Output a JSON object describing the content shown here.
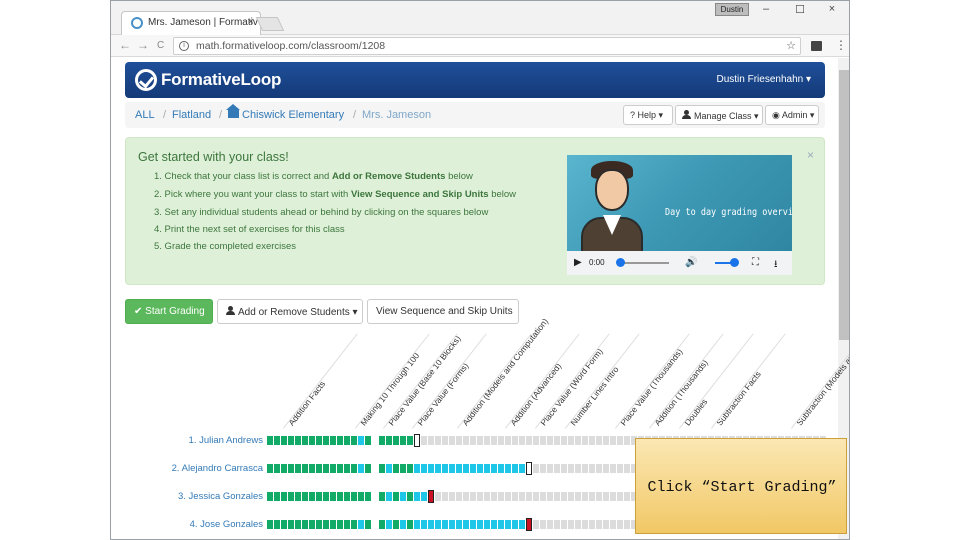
{
  "browser": {
    "tab_title": "Mrs. Jameson | Formativ",
    "tab_close": "×",
    "user_chip": "Dustin",
    "minimize": "–",
    "restore": "☐",
    "close": "×",
    "back": "←",
    "forward": "→",
    "reload": "C",
    "url": "math.formativeloop.com/classroom/1208",
    "info_glyph": "i",
    "star": "☆",
    "menu": "⋮"
  },
  "navbar": {
    "brand": "FormativeLoop",
    "user": "Dustin Friesenhahn ▾"
  },
  "breadcrumb": {
    "items": [
      "ALL",
      "Flatland",
      "Chiswick Elementary",
      "Mrs. Jameson"
    ],
    "separator": "/"
  },
  "toolbar": {
    "help": "Help ▾",
    "manage": "Manage Class ▾",
    "admin": "Admin ▾",
    "help_glyph": "?",
    "admin_glyph": "◉"
  },
  "alert": {
    "title": "Get started with your class!",
    "close": "×",
    "steps": [
      {
        "pre": "1. Check that your class list is correct and ",
        "bold": "Add or Remove Students",
        "post": " below"
      },
      {
        "pre": "2. Pick where you want your class to start with ",
        "bold": "View Sequence and Skip Units",
        "post": " below"
      },
      {
        "pre": "3. Set any individual students ahead or behind by clicking on the squares below",
        "bold": "",
        "post": ""
      },
      {
        "pre": "4. Print the next set of exercises for this class",
        "bold": "",
        "post": ""
      },
      {
        "pre": "5. Grade the completed exercises",
        "bold": "",
        "post": ""
      }
    ]
  },
  "video": {
    "caption": "Day to day grading overview",
    "time": "0:00",
    "play": "▶",
    "volume": "🔊",
    "fullscreen": "⛶",
    "download": "⭳"
  },
  "actions": {
    "start": "Start Grading",
    "start_glyph": "✔",
    "add": "Add or Remove Students ▾",
    "sequence": "View Sequence and Skip Units"
  },
  "units": [
    "Addition Facts",
    "Making 10 Through 100",
    "Place Value (Base 10 Blocks)",
    "Place Value (Forms)",
    "Addition (Models and Computation)",
    "Addition (Advanced)",
    "Place Value (Word Form)",
    "Number Lines Intro",
    "Place Value (Thousands)",
    "Addition (Thousands)",
    "Doubles",
    "Subtraction Facts",
    "Subtraction (Models and Computation)"
  ],
  "students": [
    {
      "name": "1. Julian Andrews",
      "cells": [
        "g",
        "g",
        "g",
        "g",
        "g",
        "g",
        "g",
        "g",
        "g",
        "g",
        "g",
        "g",
        "g",
        "c",
        "g",
        "x",
        "g",
        "g",
        "g",
        "g",
        "g",
        "w",
        "l",
        "l",
        "l",
        "l",
        "l",
        "l",
        "l",
        "l",
        "l",
        "l",
        "l",
        "l",
        "l",
        "l",
        "l",
        "l",
        "l",
        "l",
        "l",
        "l",
        "l",
        "l",
        "l",
        "l",
        "l",
        "l",
        "l",
        "l",
        "l",
        "l",
        "l",
        "l",
        "l",
        "l",
        "l",
        "l",
        "l",
        "l",
        "l",
        "l",
        "l",
        "l",
        "l",
        "l",
        "l",
        "l",
        "l",
        "l",
        "l",
        "l",
        "l",
        "l",
        "l",
        "l",
        "l",
        "l",
        "l",
        "l",
        "l",
        "l",
        "l"
      ]
    },
    {
      "name": "2. Alejandro Carrasca",
      "cells": [
        "g",
        "g",
        "g",
        "g",
        "g",
        "g",
        "g",
        "g",
        "g",
        "g",
        "g",
        "g",
        "g",
        "c",
        "g",
        "x",
        "g",
        "c",
        "g",
        "g",
        "g",
        "c",
        "c",
        "c",
        "c",
        "c",
        "c",
        "c",
        "c",
        "c",
        "c",
        "c",
        "c",
        "c",
        "c",
        "c",
        "c",
        "w",
        "l",
        "l",
        "l",
        "l",
        "l",
        "l",
        "l",
        "l",
        "l",
        "l",
        "l",
        "l",
        "l",
        "l",
        "l",
        "l",
        "l",
        "l",
        "l",
        "l",
        "l",
        "l",
        "l",
        "l",
        "l",
        "l",
        "l",
        "l",
        "l",
        "l",
        "l",
        "l",
        "l",
        "l",
        "l",
        "l",
        "l",
        "l",
        "l",
        "l",
        "l",
        "l",
        "l",
        "l",
        "l"
      ]
    },
    {
      "name": "3. Jessica Gonzales",
      "cells": [
        "g",
        "g",
        "g",
        "g",
        "g",
        "g",
        "g",
        "g",
        "g",
        "g",
        "g",
        "g",
        "g",
        "g",
        "g",
        "x",
        "g",
        "c",
        "g",
        "c",
        "g",
        "c",
        "c",
        "r",
        "l",
        "l",
        "l",
        "l",
        "l",
        "l",
        "l",
        "l",
        "l",
        "l",
        "l",
        "l",
        "l",
        "l",
        "l",
        "l",
        "l",
        "l",
        "l",
        "l",
        "l",
        "l",
        "l",
        "l",
        "l",
        "l",
        "l",
        "l",
        "l",
        "l",
        "l",
        "l",
        "l",
        "l",
        "l",
        "l",
        "l",
        "l",
        "l",
        "l",
        "l",
        "l",
        "l",
        "l",
        "l",
        "l",
        "l",
        "l",
        "l",
        "l",
        "l",
        "l",
        "l",
        "l",
        "l",
        "l",
        "l",
        "l",
        "l"
      ]
    },
    {
      "name": "4. Jose Gonzales",
      "cells": [
        "g",
        "g",
        "g",
        "g",
        "g",
        "g",
        "g",
        "g",
        "g",
        "g",
        "g",
        "g",
        "g",
        "c",
        "g",
        "x",
        "g",
        "c",
        "g",
        "c",
        "g",
        "c",
        "c",
        "c",
        "c",
        "c",
        "c",
        "c",
        "c",
        "c",
        "c",
        "c",
        "c",
        "c",
        "c",
        "c",
        "c",
        "r",
        "l",
        "l",
        "l",
        "l",
        "l",
        "l",
        "l",
        "l",
        "l",
        "l",
        "l",
        "l",
        "l",
        "l",
        "l",
        "l",
        "l",
        "l",
        "l",
        "l",
        "l",
        "l",
        "l",
        "l",
        "l",
        "l",
        "l",
        "l",
        "l",
        "l",
        "l",
        "l",
        "l",
        "l",
        "l",
        "l",
        "l",
        "l",
        "l",
        "l",
        "l",
        "l",
        "l",
        "l",
        "l"
      ]
    }
  ],
  "callout": {
    "text": "Click “Start Grading”"
  },
  "colors": {
    "navbar": "#1f4f9a",
    "alert_bg": "#dff0d8",
    "success": "#5cb85c",
    "mastered": "#11aa66",
    "in_progress": "#1ec7e8",
    "not_started": "#dcdcdc",
    "flag": "#cc1122",
    "callout": "#f1c866"
  }
}
